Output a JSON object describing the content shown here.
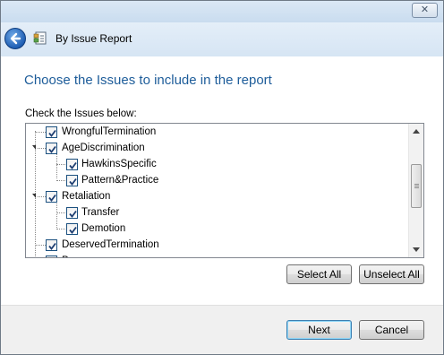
{
  "window": {
    "close_symbol": "✕"
  },
  "header": {
    "title": "By Issue Report",
    "back_icon": "back-arrow-icon",
    "report_icon": "report-icon"
  },
  "heading": "Choose the Issues to include in the report",
  "instruction": "Check the Issues below:",
  "tree": {
    "items": [
      {
        "label": "WrongfulTermination",
        "checked": true,
        "level": 0
      },
      {
        "label": "AgeDiscrimination",
        "checked": true,
        "level": 0,
        "expanded": true
      },
      {
        "label": "HawkinsSpecific",
        "checked": true,
        "level": 1
      },
      {
        "label": "Pattern&Practice",
        "checked": true,
        "level": 1
      },
      {
        "label": "Retaliation",
        "checked": true,
        "level": 0,
        "expanded": true
      },
      {
        "label": "Transfer",
        "checked": true,
        "level": 1
      },
      {
        "label": "Demotion",
        "checked": true,
        "level": 1
      },
      {
        "label": "DeservedTermination",
        "checked": true,
        "level": 0
      },
      {
        "label": "P",
        "checked": true,
        "level": 0
      }
    ]
  },
  "buttons": {
    "select_all": "Select All",
    "unselect_all": "Unselect All",
    "next": "Next",
    "cancel": "Cancel"
  },
  "colors": {
    "heading": "#1e5d9a",
    "header_bg": "#dce9f6",
    "footer_bg": "#f0f0f0"
  }
}
